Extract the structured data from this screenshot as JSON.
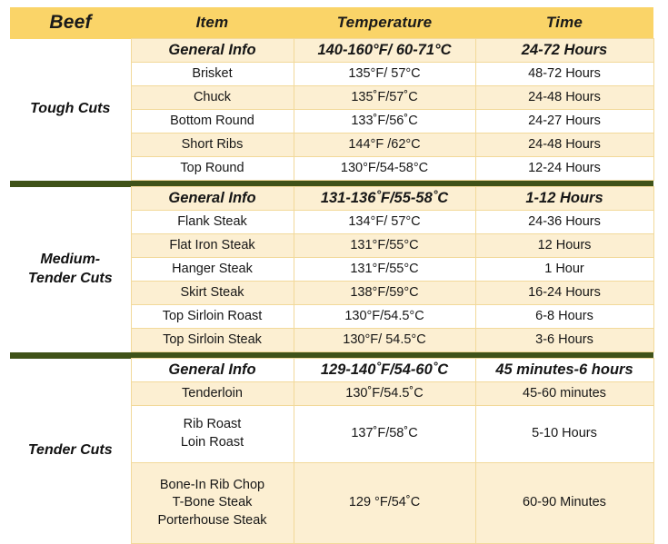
{
  "header": {
    "group_label": "Beef",
    "columns": [
      "Item",
      "Temperature",
      "Time"
    ]
  },
  "colors": {
    "header_band": "#FAD468",
    "row_shade": "#FCEFD2",
    "row_plain": "#FFFFFF",
    "grid_line": "#F2D99A",
    "divider": "#3F5218",
    "text": "#161616"
  },
  "sections": [
    {
      "name": "Tough Cuts",
      "rows": [
        {
          "item": "General Info",
          "temperature": "140-160°F/ 60-71°C",
          "time": "24-72 Hours",
          "emphasis": true,
          "shade": true
        },
        {
          "item": "Brisket",
          "temperature": "135°F/ 57°C",
          "time": "48-72 Hours",
          "emphasis": false,
          "shade": false
        },
        {
          "item": "Chuck",
          "temperature": "135˚F/57˚C",
          "time": "24-48 Hours",
          "emphasis": false,
          "shade": true
        },
        {
          "item": "Bottom Round",
          "temperature": "133˚F/56˚C",
          "time": "24-27 Hours",
          "emphasis": false,
          "shade": false
        },
        {
          "item": "Short Ribs",
          "temperature": "144°F /62°C",
          "time": "24-48 Hours",
          "emphasis": false,
          "shade": true
        },
        {
          "item": "Top Round",
          "temperature": "130°F/54-58°C",
          "time": "12-24 Hours",
          "emphasis": false,
          "shade": false
        }
      ]
    },
    {
      "name": "Medium-Tender Cuts",
      "name_lines": [
        "Medium-",
        "Tender Cuts"
      ],
      "rows": [
        {
          "item": "General Info",
          "temperature": "131-136˚F/55-58˚C",
          "time": "1-12 Hours",
          "emphasis": true,
          "shade": true
        },
        {
          "item": "Flank Steak",
          "temperature": "134°F/ 57°C",
          "time": "24-36 Hours",
          "emphasis": false,
          "shade": false
        },
        {
          "item": "Flat Iron Steak",
          "temperature": "131°F/55°C",
          "time": "12 Hours",
          "emphasis": false,
          "shade": true
        },
        {
          "item": "Hanger Steak",
          "temperature": "131°F/55°C",
          "time": "1 Hour",
          "emphasis": false,
          "shade": false
        },
        {
          "item": "Skirt Steak",
          "temperature": "138°F/59°C",
          "time": "16-24 Hours",
          "emphasis": false,
          "shade": true
        },
        {
          "item": "Top Sirloin Roast",
          "temperature": "130°F/54.5°C",
          "time": "6-8 Hours",
          "emphasis": false,
          "shade": false
        },
        {
          "item": "Top Sirloin Steak",
          "temperature": "130°F/ 54.5°C",
          "time": "3-6 Hours",
          "emphasis": false,
          "shade": true
        }
      ]
    },
    {
      "name": "Tender Cuts",
      "rows": [
        {
          "item": "General Info",
          "temperature": "129-140˚F/54-60˚C",
          "time": "45 minutes-6 hours",
          "emphasis": true,
          "shade": false
        },
        {
          "item": "Tenderloin",
          "temperature": "130˚F/54.5˚C",
          "time": "45-60 minutes",
          "emphasis": false,
          "shade": true
        },
        {
          "item_lines": [
            "Rib Roast",
            "Loin Roast"
          ],
          "temperature": "137˚F/58˚C",
          "time": "5-10 Hours",
          "emphasis": false,
          "shade": false
        },
        {
          "item_lines": [
            "Bone-In Rib Chop",
            "T-Bone Steak",
            "Porterhouse Steak"
          ],
          "temperature": "129 °F/54˚C",
          "time": "60-90 Minutes",
          "emphasis": false,
          "shade": true
        }
      ]
    }
  ]
}
